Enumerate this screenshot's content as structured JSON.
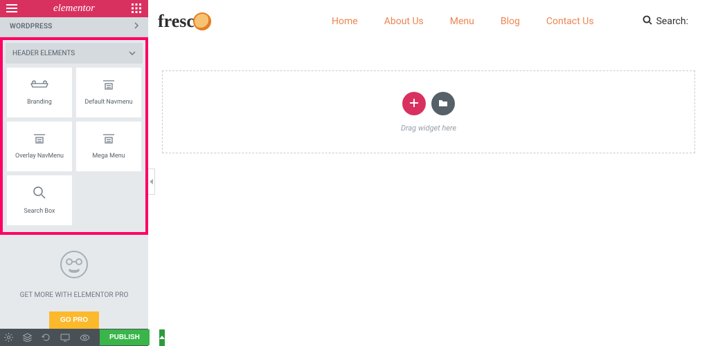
{
  "sidebar": {
    "brand": "elementor",
    "sections": {
      "wordpress": "WORDPRESS",
      "header_elements": "HEADER ELEMENTS"
    },
    "widgets": [
      {
        "label": "Branding"
      },
      {
        "label": "Default Navmenu"
      },
      {
        "label": "Overlay NavMenu"
      },
      {
        "label": "Mega Menu"
      },
      {
        "label": "Search Box"
      }
    ],
    "promo": {
      "text": "GET MORE WITH ELEMENTOR PRO",
      "cta": "GO PRO"
    },
    "footer": {
      "publish": "PUBLISH"
    }
  },
  "site": {
    "logo_text": "fresc",
    "nav": [
      {
        "label": "Home"
      },
      {
        "label": "About Us"
      },
      {
        "label": "Menu"
      },
      {
        "label": "Blog"
      },
      {
        "label": "Contact Us"
      }
    ],
    "search_label": "Search:"
  },
  "dropzone": {
    "hint": "Drag widget here"
  }
}
